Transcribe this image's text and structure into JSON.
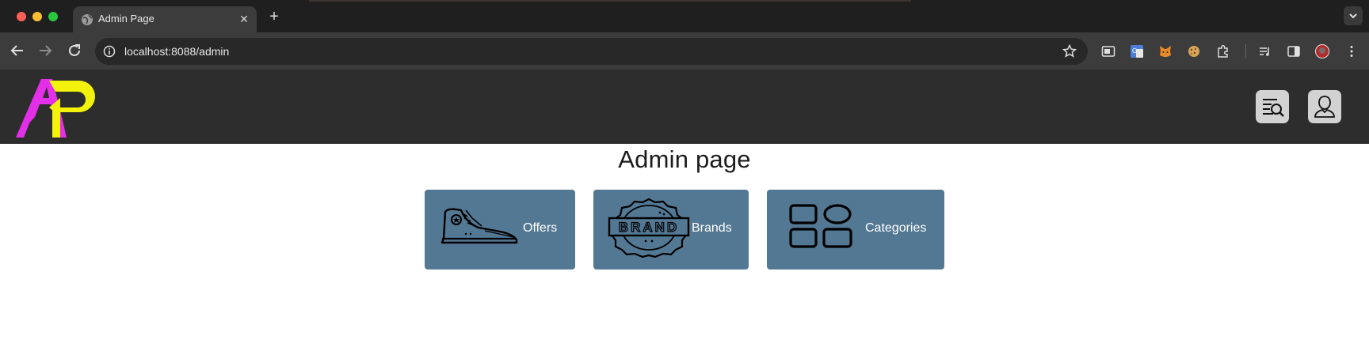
{
  "browser": {
    "tab_title": "Admin Page",
    "tab_close_glyph": "✕",
    "new_tab_glyph": "+",
    "url": "localhost:8088/admin",
    "extensions": [
      "picture-in-picture-icon",
      "translate-icon",
      "metamask-icon",
      "cookie-icon",
      "puzzle-icon",
      "media-queue-icon",
      "side-panel-icon",
      "profile-avatar-icon",
      "kebab-menu-icon"
    ]
  },
  "header": {
    "logo_icon": "ap-logo",
    "buttons": [
      "search-list-icon",
      "user-icon"
    ]
  },
  "main": {
    "title": "Admin page",
    "cards": [
      {
        "label": "Offers",
        "icon": "sneaker-icon"
      },
      {
        "label": "Brands",
        "icon": "brand-badge-icon",
        "icon_text": "BRAND"
      },
      {
        "label": "Categories",
        "icon": "categories-grid-icon"
      }
    ]
  },
  "colors": {
    "card_bg": "#537894",
    "header_bg": "#2d2d2d",
    "logo_magenta": "#e42fe9",
    "logo_yellow": "#f2f20a"
  }
}
